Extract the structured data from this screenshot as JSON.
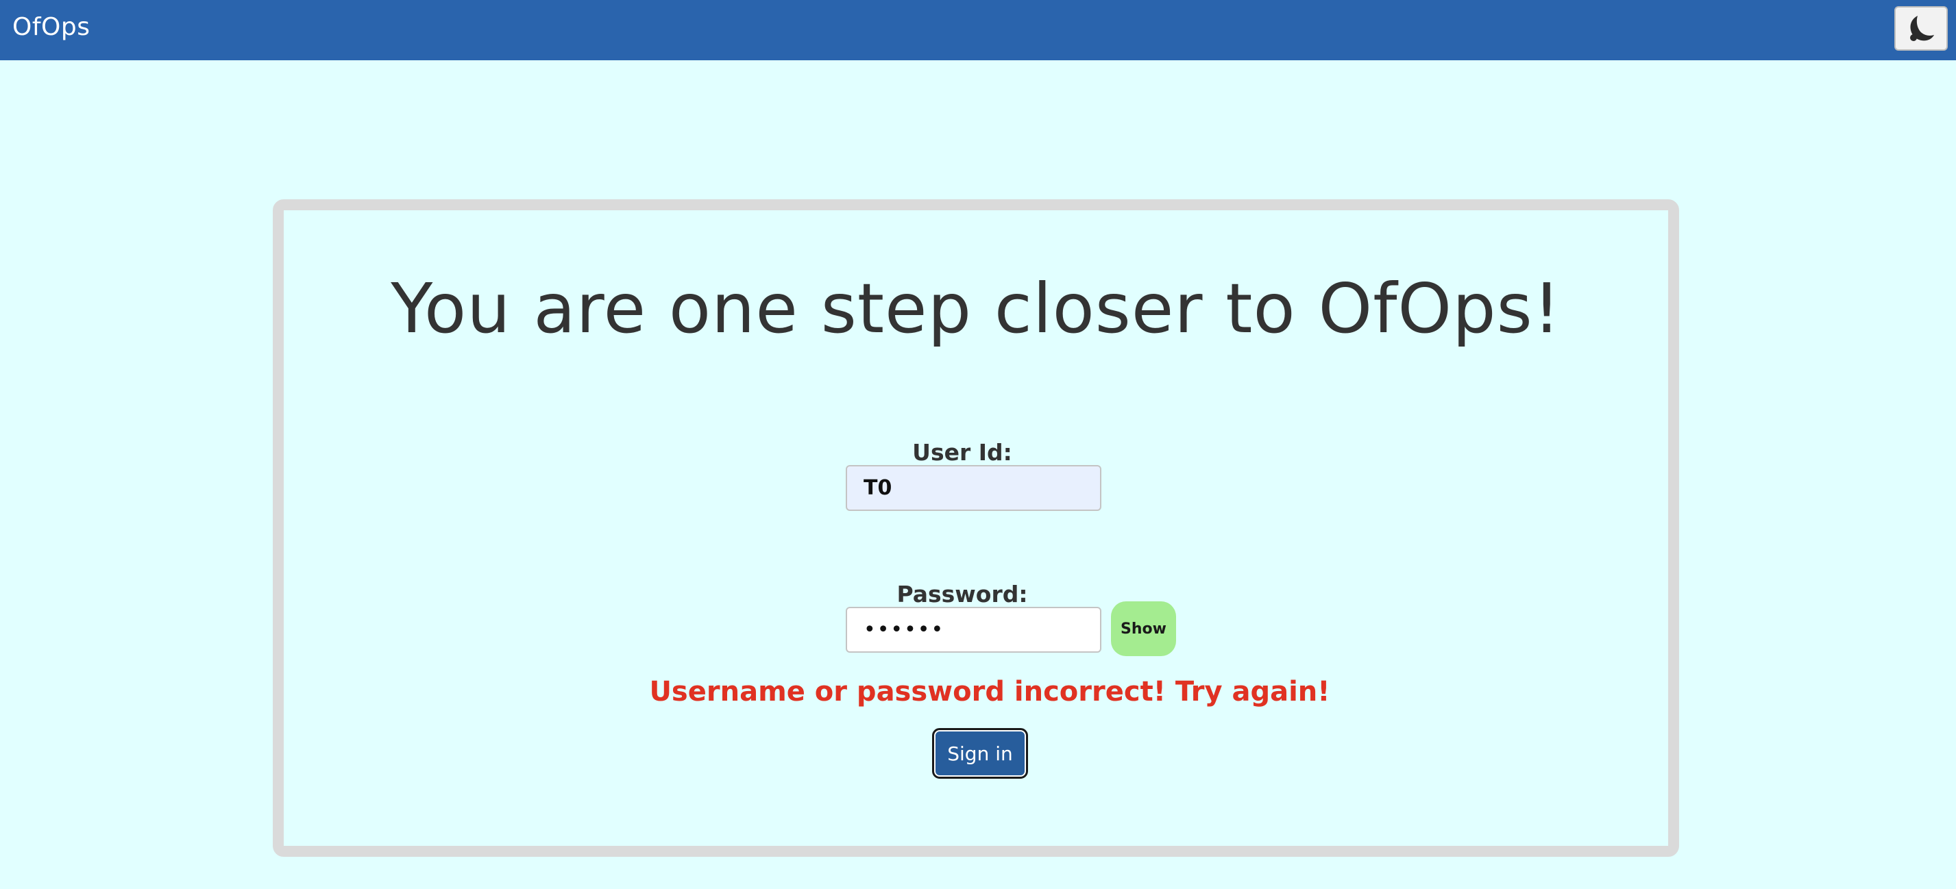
{
  "header": {
    "brand": "OfOps",
    "theme_toggle_icon": "moon-icon"
  },
  "login": {
    "headline": "You are one step closer to OfOps!",
    "userid_label": "User Id:",
    "userid_value": "T0",
    "password_label": "Password:",
    "password_value": "••••••",
    "show_label": "Show",
    "error": "Username or password incorrect! Try again!",
    "signin_label": "Sign in"
  },
  "colors": {
    "topbar": "#2a64ad",
    "background": "#e1ffff",
    "error": "#e03222",
    "show_button": "#a4ec90"
  }
}
